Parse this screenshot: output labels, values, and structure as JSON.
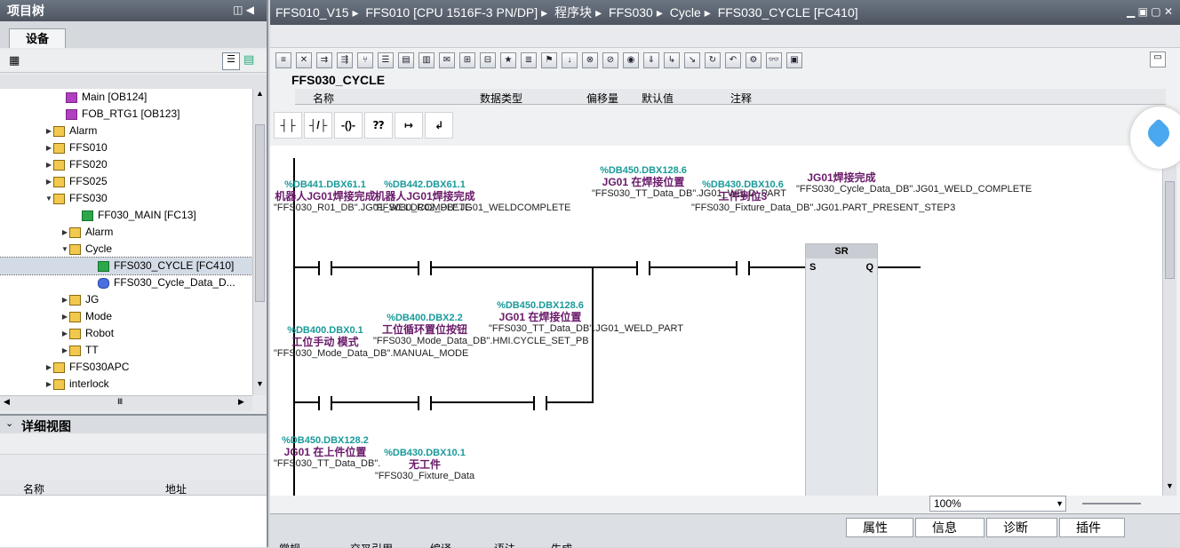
{
  "left": {
    "title": "项目树",
    "tab": "设备",
    "tree": [
      {
        "label": "Main [OB124]",
        "icon": "ob",
        "indent": 76,
        "arrow": ""
      },
      {
        "label": "FOB_RTG1 [OB123]",
        "icon": "ob",
        "indent": 76,
        "arrow": ""
      },
      {
        "label": "Alarm",
        "icon": "folder",
        "indent": 62,
        "arrow": "▶"
      },
      {
        "label": "FFS010",
        "icon": "folder",
        "indent": 62,
        "arrow": "▶"
      },
      {
        "label": "FFS020",
        "icon": "folder",
        "indent": 62,
        "arrow": "▶"
      },
      {
        "label": "FFS025",
        "icon": "folder",
        "indent": 62,
        "arrow": "▶"
      },
      {
        "label": "FFS030",
        "icon": "folder",
        "indent": 62,
        "arrow": "▼"
      },
      {
        "label": "FF030_MAIN [FC13]",
        "icon": "fc",
        "indent": 94,
        "arrow": ""
      },
      {
        "label": "Alarm",
        "icon": "folder",
        "indent": 80,
        "arrow": "▶"
      },
      {
        "label": "Cycle",
        "icon": "folder",
        "indent": 80,
        "arrow": "▼"
      },
      {
        "label": "FFS030_CYCLE [FC410]",
        "icon": "fc",
        "indent": 112,
        "arrow": "",
        "selected": true
      },
      {
        "label": "FFS030_Cycle_Data_D...",
        "icon": "db",
        "indent": 112,
        "arrow": ""
      },
      {
        "label": "JG",
        "icon": "folder",
        "indent": 80,
        "arrow": "▶"
      },
      {
        "label": "Mode",
        "icon": "folder",
        "indent": 80,
        "arrow": "▶"
      },
      {
        "label": "Robot",
        "icon": "folder",
        "indent": 80,
        "arrow": "▶"
      },
      {
        "label": "TT",
        "icon": "folder",
        "indent": 80,
        "arrow": "▶"
      },
      {
        "label": "FFS030APC",
        "icon": "folder",
        "indent": 62,
        "arrow": "▶"
      },
      {
        "label": "interlock",
        "icon": "folder",
        "indent": 62,
        "arrow": "▶"
      }
    ],
    "detail_title": "详细视图",
    "detail_cols": [
      "名称",
      "地址"
    ]
  },
  "main": {
    "breadcrumb": [
      "FFS010_V15",
      "FFS010 [CPU 1516F-3 PN/DP]",
      "程序块",
      "FFS030",
      "Cycle",
      "FFS030_CYCLE [FC410]"
    ],
    "block_name": "FFS030_CYCLE",
    "iface_cols": [
      "名称",
      "数据类型",
      "偏移量",
      "默认值",
      "注释"
    ],
    "zoom": "100%",
    "bottom_tabs": [
      "属性",
      "信息",
      "诊断",
      "插件"
    ],
    "bottom_sub_tabs": [
      "常规",
      "交叉引用",
      "编译",
      "语法",
      "生成"
    ]
  },
  "ladder": {
    "row1": [
      {
        "addr": "%DB441.DBX61.1",
        "cmt": "机器人JG01焊接完成",
        "op": "\"FFS030_R01_DB\".JG01_WELDCOMPLETE"
      },
      {
        "addr": "%DB442.DBX61.1",
        "cmt": "机器人JG01焊接完成",
        "op": "\"FFS030_R02_DB\".JG01_WELDCOMPLETE"
      },
      {
        "addr": "%DB450.DBX128.6",
        "cmt": "JG01 在焊接位置",
        "op": "\"FFS030_TT_Data_DB\".JG01_WELD_PART"
      },
      {
        "addr": "%DB430.DBX10.6",
        "cmt": "工件到位3",
        "op": "\"FFS030_Fixture_Data_DB\".JG01.PART_PRESENT_STEP3"
      }
    ],
    "coil": {
      "cmt": "JG01焊接完成",
      "op": "\"FFS030_Cycle_Data_DB\".JG01_WELD_COMPLETE",
      "box": "SR",
      "s": "S",
      "q": "Q"
    },
    "row2": [
      {
        "addr": "%DB400.DBX0.1",
        "cmt": "工位手动 模式",
        "op": "\"FFS030_Mode_Data_DB\".MANUAL_MODE"
      },
      {
        "addr": "%DB400.DBX2.2",
        "cmt": "工位循环置位按钮",
        "op": "\"FFS030_Mode_Data_DB\".HMI.CYCLE_SET_PB"
      },
      {
        "addr": "%DB450.DBX128.6",
        "cmt": "JG01 在焊接位置",
        "op": "\"FFS030_TT_Data_DB\".JG01_WELD_PART"
      }
    ],
    "row3": [
      {
        "addr": "%DB450.DBX128.2",
        "cmt": "JG01 在上件位置",
        "op": "\"FFS030_TT_Data_DB\"."
      },
      {
        "addr": "%DB430.DBX10.1",
        "cmt": "无工件",
        "op": "\"FFS030_Fixture_Data"
      }
    ]
  }
}
